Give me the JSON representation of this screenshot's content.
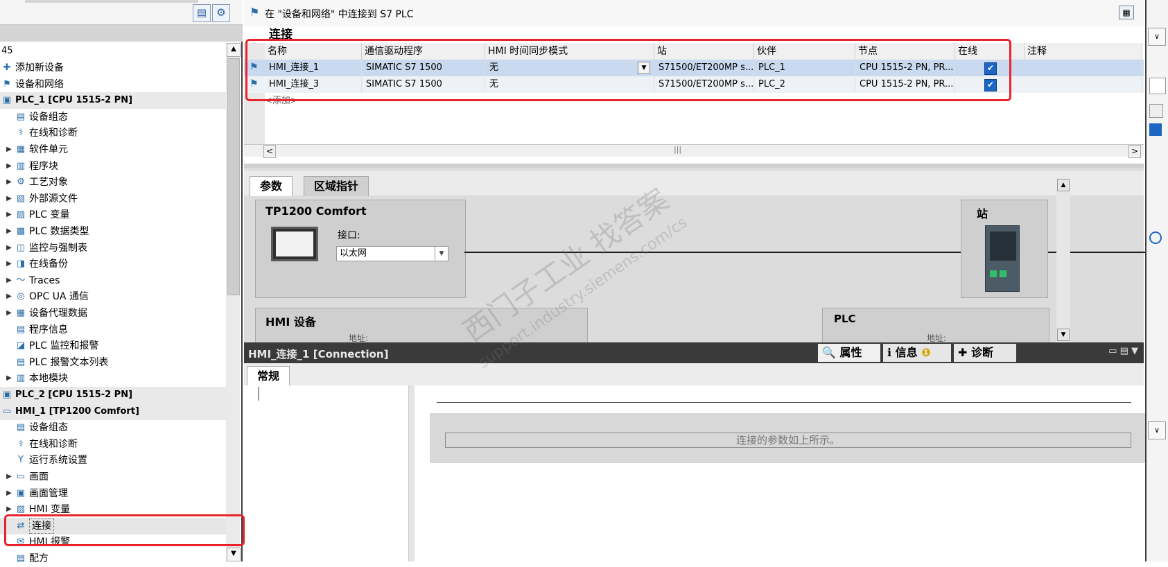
{
  "tree": {
    "header_count": "45",
    "items": [
      {
        "label": "添加新设备",
        "icon": "add-device-icon",
        "arrow": ""
      },
      {
        "label": "设备和网络",
        "icon": "network-icon",
        "arrow": ""
      },
      {
        "label": "PLC_1 [CPU 1515-2 PN]",
        "icon": "plc-icon",
        "arrow": "",
        "group": true
      },
      {
        "label": "设备组态",
        "icon": "config-icon",
        "arrow": ""
      },
      {
        "label": "在线和诊断",
        "icon": "diagnostic-icon",
        "arrow": ""
      },
      {
        "label": "软件单元",
        "icon": "software-unit-icon",
        "arrow": "▶"
      },
      {
        "label": "程序块",
        "icon": "program-block-icon",
        "arrow": "▶"
      },
      {
        "label": "工艺对象",
        "icon": "technology-object-icon",
        "arrow": "▶"
      },
      {
        "label": "外部源文件",
        "icon": "external-source-icon",
        "arrow": "▶"
      },
      {
        "label": "PLC 变量",
        "icon": "plc-tag-icon",
        "arrow": "▶"
      },
      {
        "label": "PLC 数据类型",
        "icon": "plc-datatype-icon",
        "arrow": "▶"
      },
      {
        "label": "监控与强制表",
        "icon": "watch-table-icon",
        "arrow": "▶"
      },
      {
        "label": "在线备份",
        "icon": "online-backup-icon",
        "arrow": "▶"
      },
      {
        "label": "Traces",
        "icon": "traces-icon",
        "arrow": "▶"
      },
      {
        "label": "OPC UA 通信",
        "icon": "opcua-icon",
        "arrow": "▶"
      },
      {
        "label": "设备代理数据",
        "icon": "proxy-data-icon",
        "arrow": "▶"
      },
      {
        "label": "程序信息",
        "icon": "program-info-icon",
        "arrow": ""
      },
      {
        "label": "PLC 监控和报警",
        "icon": "supervision-icon",
        "arrow": ""
      },
      {
        "label": "PLC 报警文本列表",
        "icon": "alarm-text-icon",
        "arrow": ""
      },
      {
        "label": "本地模块",
        "icon": "local-module-icon",
        "arrow": "▶"
      },
      {
        "label": "PLC_2 [CPU 1515-2 PN]",
        "icon": "plc-icon",
        "arrow": "",
        "group": true
      },
      {
        "label": "HMI_1 [TP1200 Comfort]",
        "icon": "hmi-icon",
        "arrow": "",
        "group": true
      },
      {
        "label": "设备组态",
        "icon": "config-icon",
        "arrow": ""
      },
      {
        "label": "在线和诊断",
        "icon": "diagnostic-icon",
        "arrow": ""
      },
      {
        "label": "运行系统设置",
        "icon": "runtime-settings-icon",
        "arrow": ""
      },
      {
        "label": "画面",
        "icon": "screen-folder-icon",
        "arrow": "▶"
      },
      {
        "label": "画面管理",
        "icon": "screen-mgmt-icon",
        "arrow": "▶"
      },
      {
        "label": "HMI 变量",
        "icon": "hmi-tag-icon",
        "arrow": "▶"
      },
      {
        "label": "连接",
        "icon": "connection-icon",
        "arrow": "",
        "selected": true
      },
      {
        "label": "HMI 报警",
        "icon": "hmi-alarm-icon",
        "arrow": ""
      },
      {
        "label": "配方",
        "icon": "recipe-icon",
        "arrow": ""
      }
    ]
  },
  "main": {
    "title": "在 \"设备和网络\" 中连接到 S7 PLC",
    "section": "连接",
    "columns": [
      "名称",
      "通信驱动程序",
      "HMI 时间同步模式",
      "站",
      "伙伴",
      "节点",
      "在线",
      "注释"
    ],
    "rows": [
      [
        "HMI_连接_1",
        "SIMATIC S7 1500",
        "无",
        "S71500/ET200MP s...",
        "PLC_1",
        "CPU 1515-2 PN, PR...",
        "✔",
        ""
      ],
      [
        "HMI_连接_3",
        "SIMATIC S7 1500",
        "无",
        "S71500/ET200MP s...",
        "PLC_2",
        "CPU 1515-2 PN, PR...",
        "✔",
        ""
      ]
    ],
    "add_row": "<添加>"
  },
  "params": {
    "tabs": [
      "参数",
      "区域指针"
    ],
    "device": "TP1200 Comfort",
    "interface_label": "接口:",
    "interface_value": "以太网",
    "station": "站",
    "hmi_device": "HMI 设备",
    "plc": "PLC",
    "address_label": "地址:"
  },
  "props": {
    "title": "HMI_连接_1 [Connection]",
    "tabs": [
      "属性",
      "信息",
      "诊断"
    ],
    "general_tab": "常规",
    "message": "连接的参数如上所示。"
  },
  "watermark": {
    "cn": "西门子工业 找答案",
    "url": "support.industry.siemens.com/cs"
  }
}
